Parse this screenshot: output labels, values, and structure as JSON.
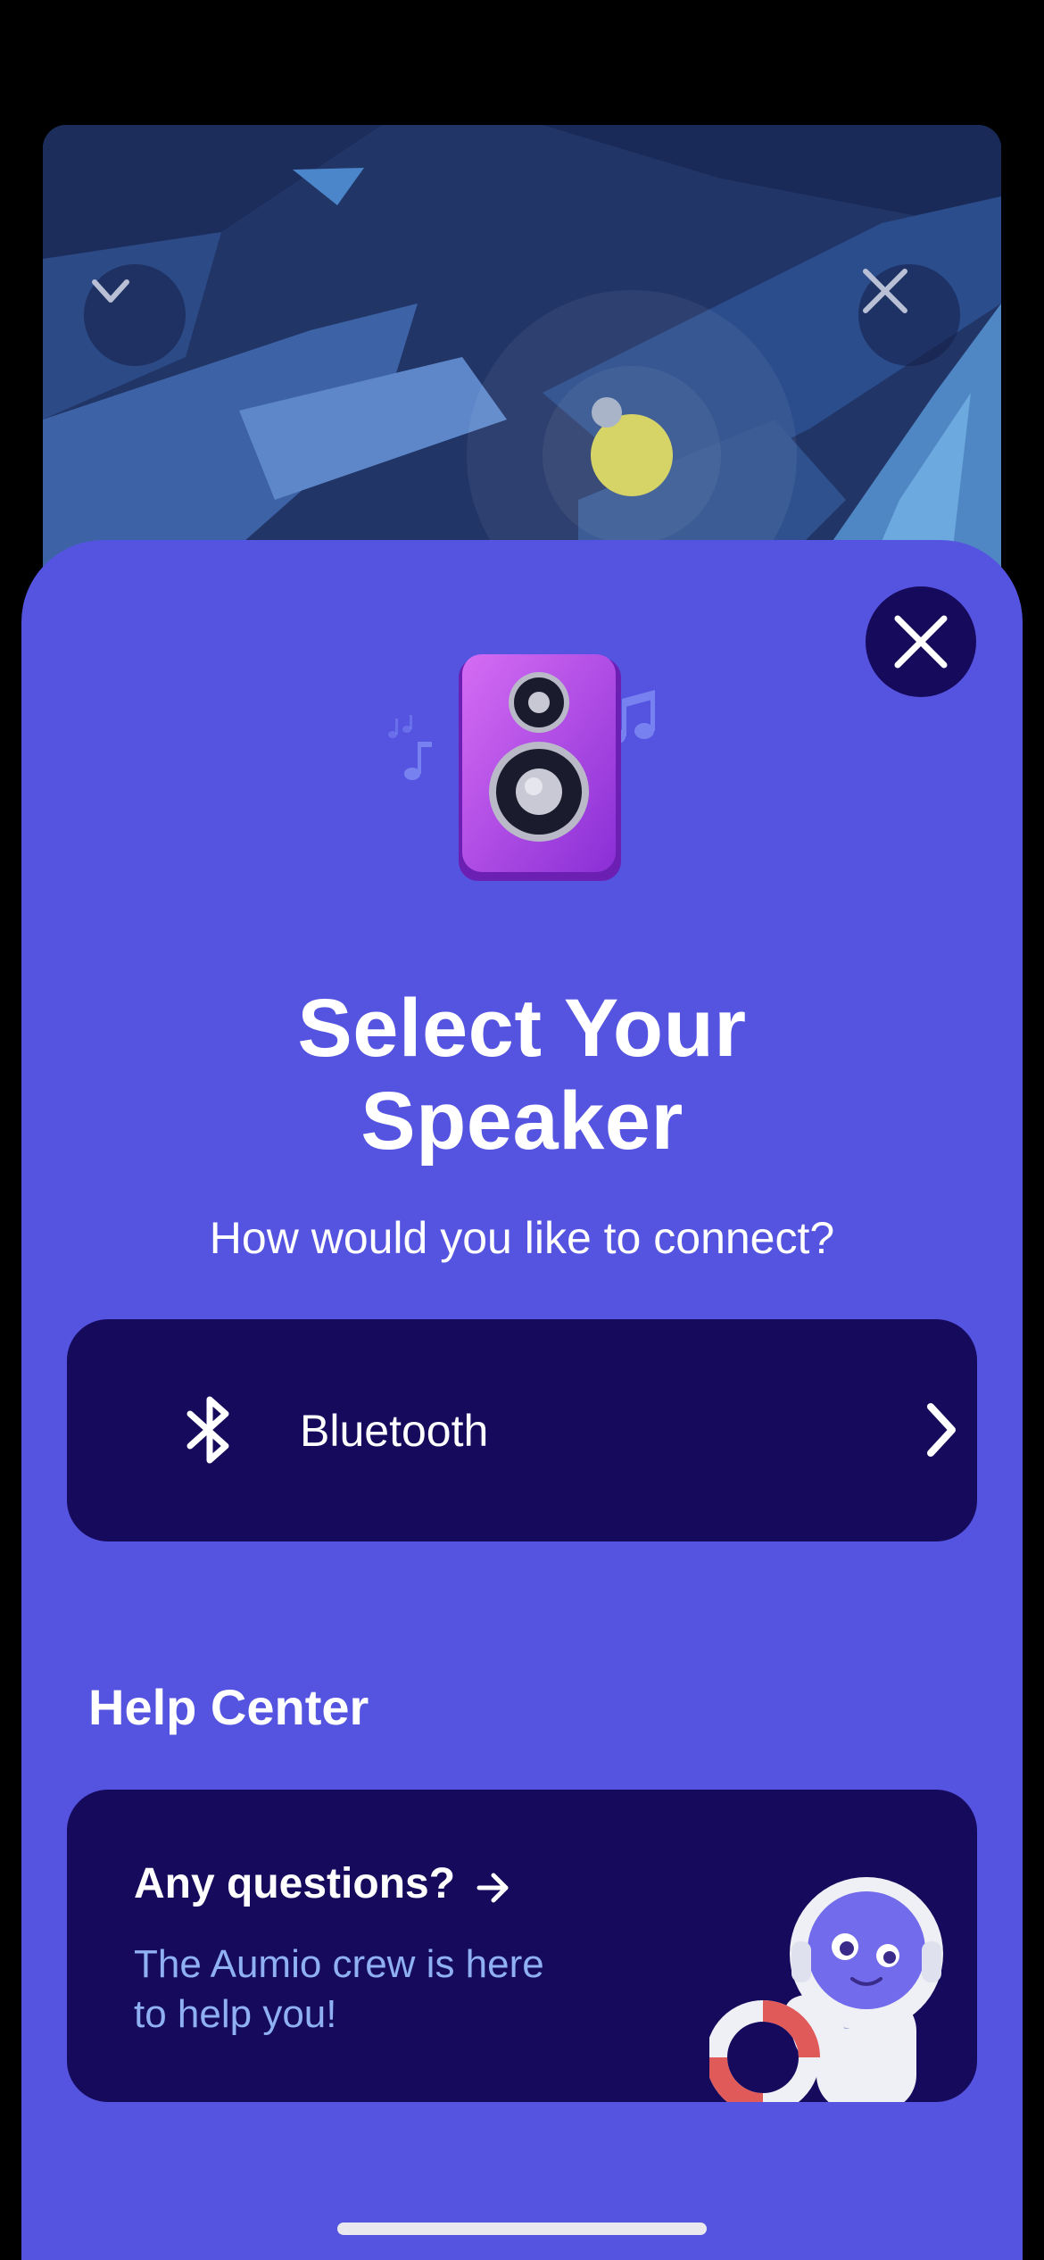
{
  "background_player": {
    "collapse_icon": "chevron-down-icon",
    "close_icon": "close-icon"
  },
  "sheet": {
    "close_icon": "close-icon",
    "illustration": "speaker-icon",
    "title_line1": "Select Your",
    "title_line2": "Speaker",
    "subtitle": "How would you like to connect?",
    "connection_option": {
      "icon": "bluetooth-icon",
      "label": "Bluetooth",
      "chevron": "chevron-right-icon"
    },
    "help_heading": "Help Center",
    "help_card": {
      "title": "Any questions?",
      "arrow_icon": "arrow-right-icon",
      "text": "The Aumio crew is here to help you!",
      "illustration": "astronaut-icon"
    }
  },
  "colors": {
    "sheet_bg": "#5554e0",
    "card_bg": "#150a5c",
    "help_text": "#8fb0f5"
  }
}
